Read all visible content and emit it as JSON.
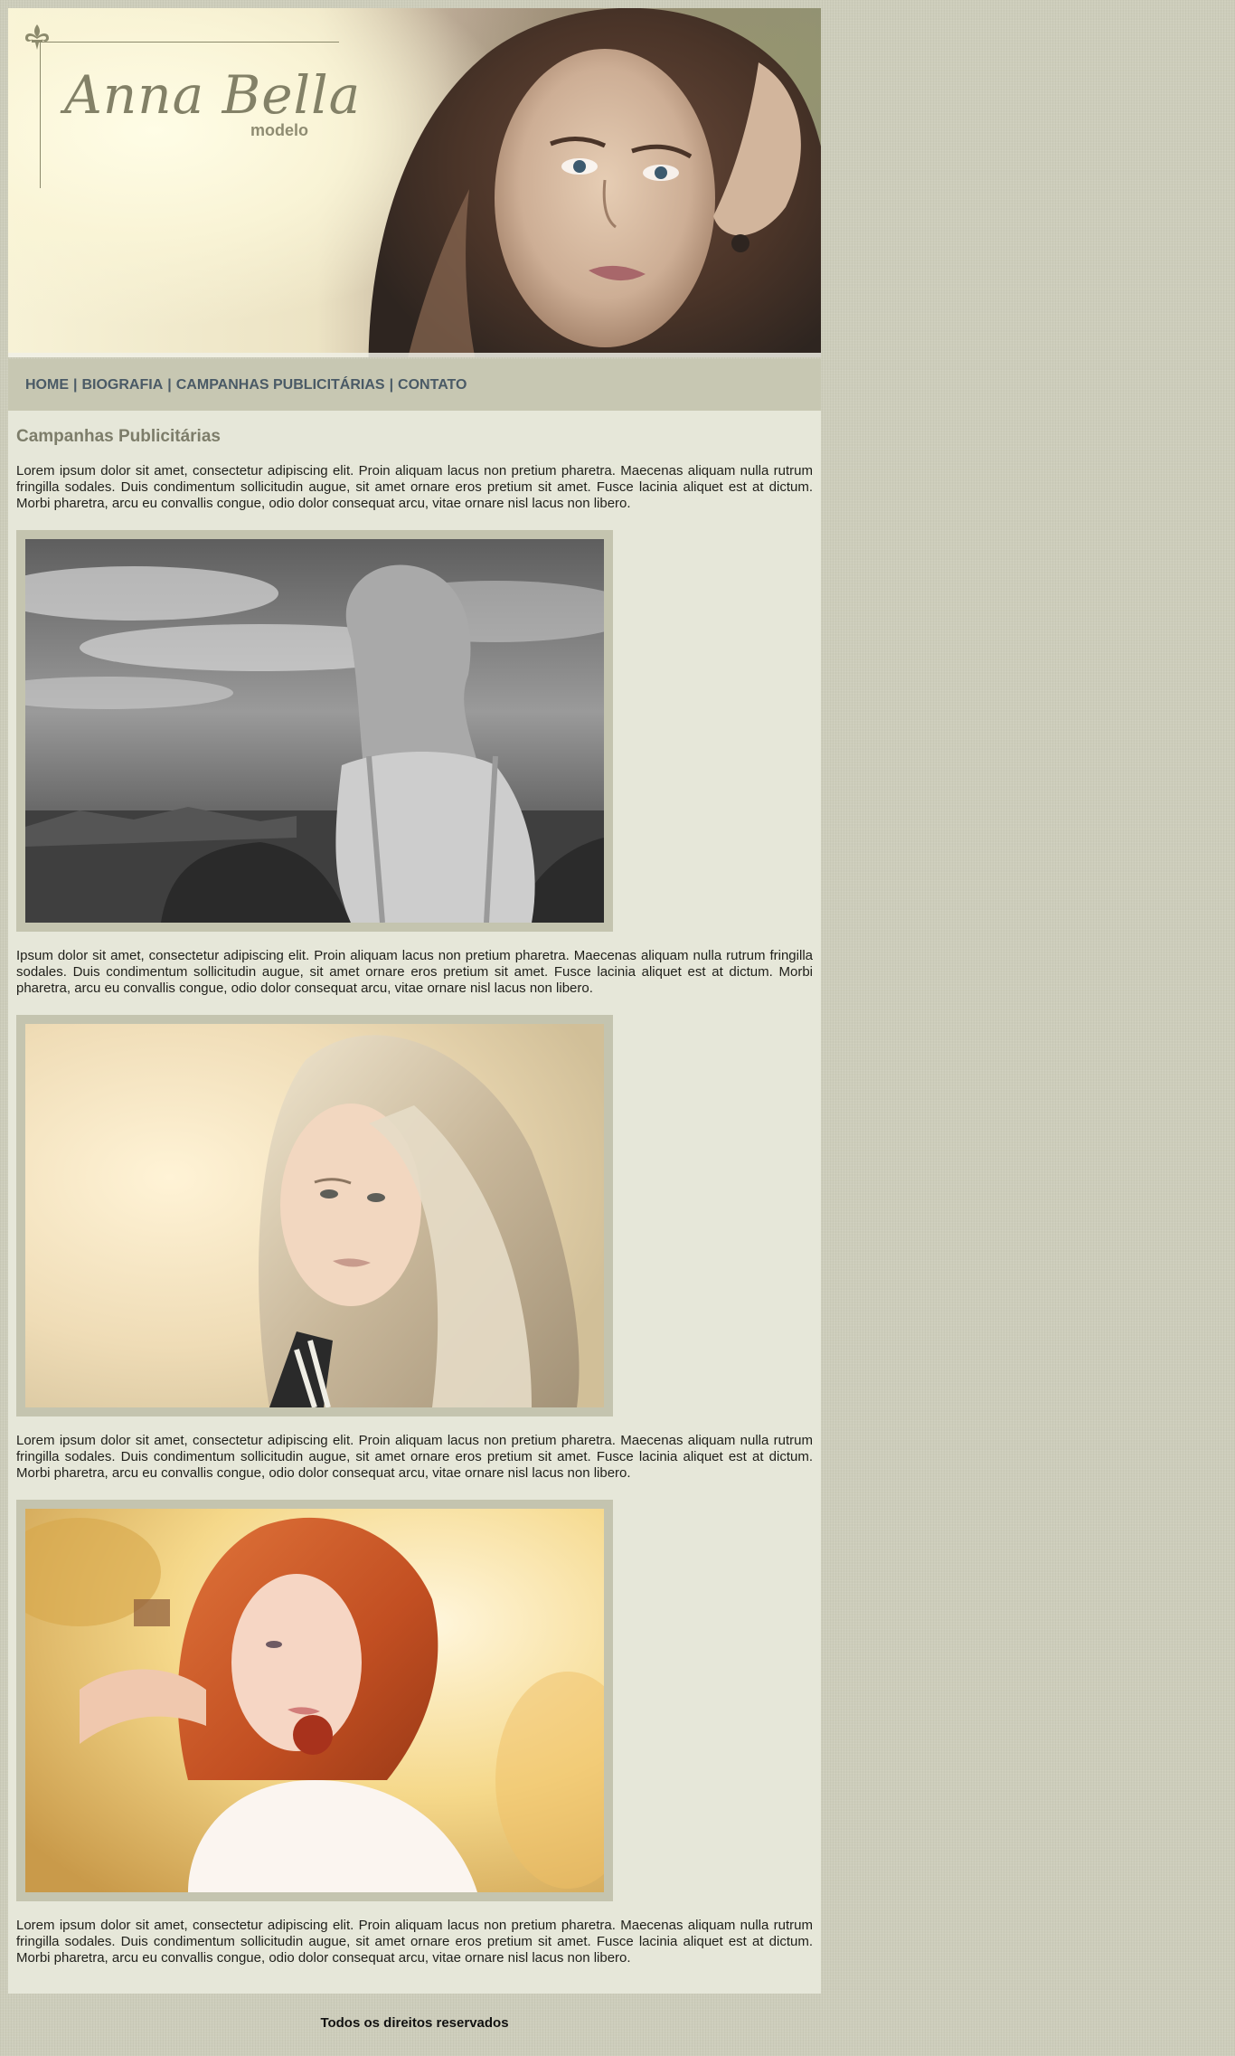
{
  "header": {
    "brand_name": "Anna Bella",
    "brand_subtitle": "modelo",
    "logo_icon": "fleur-de-lis-icon"
  },
  "nav": {
    "items": [
      {
        "label": "HOME"
      },
      {
        "label": "BIOGRAFIA"
      },
      {
        "label": "CAMPANHAS PUBLICITÁRIAS"
      },
      {
        "label": "CONTATO"
      }
    ],
    "separator": "|"
  },
  "content": {
    "title": "Campanhas Publicitárias",
    "paragraphs": [
      "Lorem ipsum dolor sit amet, consectetur adipiscing elit. Proin aliquam lacus non pretium pharetra. Maecenas aliquam nulla rutrum fringilla sodales. Duis condimentum sollicitudin augue, sit amet ornare eros pretium sit amet. Fusce lacinia aliquet est at dictum. Morbi pharetra, arcu eu convallis congue, odio dolor consequat arcu, vitae ornare nisl lacus non libero.",
      "Ipsum dolor sit amet, consectetur adipiscing elit. Proin aliquam lacus non pretium pharetra. Maecenas aliquam nulla rutrum fringilla sodales. Duis condimentum sollicitudin augue, sit amet ornare eros pretium sit amet. Fusce lacinia aliquet est at dictum. Morbi pharetra, arcu eu convallis congue, odio dolor consequat arcu, vitae ornare nisl lacus non libero.",
      "Lorem ipsum dolor sit amet, consectetur adipiscing elit. Proin aliquam lacus non pretium pharetra. Maecenas aliquam nulla rutrum fringilla sodales. Duis condimentum sollicitudin augue, sit amet ornare eros pretium sit amet. Fusce lacinia aliquet est at dictum. Morbi pharetra, arcu eu convallis congue, odio dolor consequat arcu, vitae ornare nisl lacus non libero.",
      "Lorem ipsum dolor sit amet, consectetur adipiscing elit. Proin aliquam lacus non pretium pharetra. Maecenas aliquam nulla rutrum fringilla sodales. Duis condimentum sollicitudin augue, sit amet ornare eros pretium sit amet. Fusce lacinia aliquet est at dictum. Morbi pharetra, arcu eu convallis congue, odio dolor consequat arcu, vitae ornare nisl lacus non libero."
    ]
  },
  "footer": {
    "text": "Todos os direitos reservados"
  },
  "colors": {
    "page_background": "#cdcdbb",
    "content_background": "#e6e7d9",
    "nav_background": "#c7c7b2",
    "nav_text": "#4a5a66",
    "heading_text": "#7d7d6a",
    "photo_frame": "#c4c4af"
  }
}
